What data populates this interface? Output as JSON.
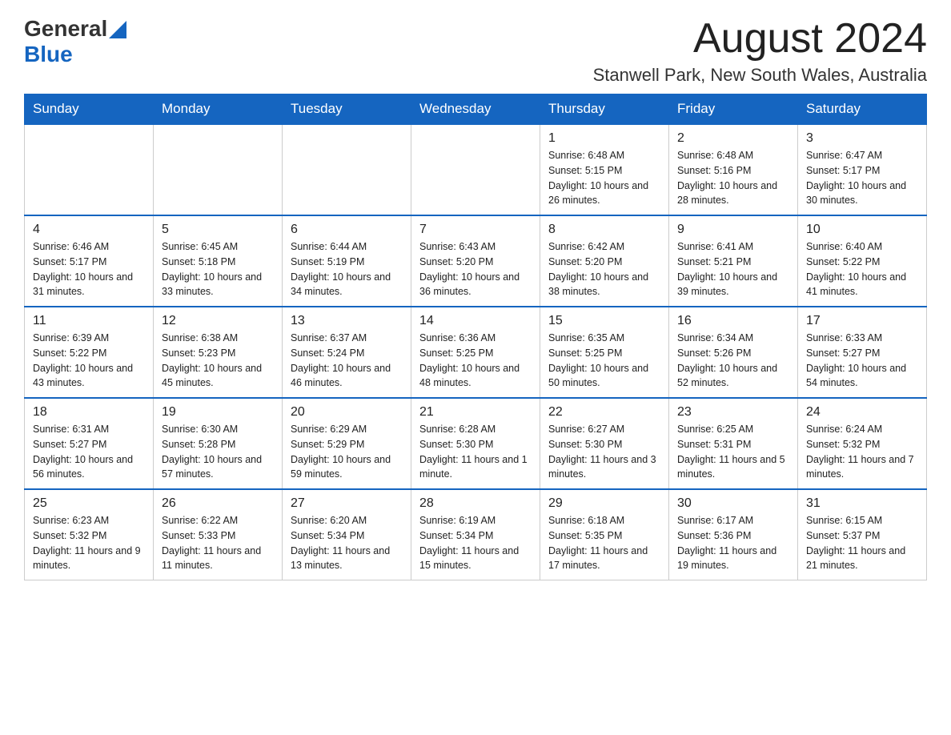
{
  "header": {
    "logo_general": "General",
    "logo_blue": "Blue",
    "month_title": "August 2024",
    "location": "Stanwell Park, New South Wales, Australia"
  },
  "days_of_week": [
    "Sunday",
    "Monday",
    "Tuesday",
    "Wednesday",
    "Thursday",
    "Friday",
    "Saturday"
  ],
  "weeks": [
    {
      "days": [
        {
          "number": "",
          "info": ""
        },
        {
          "number": "",
          "info": ""
        },
        {
          "number": "",
          "info": ""
        },
        {
          "number": "",
          "info": ""
        },
        {
          "number": "1",
          "info": "Sunrise: 6:48 AM\nSunset: 5:15 PM\nDaylight: 10 hours and 26 minutes."
        },
        {
          "number": "2",
          "info": "Sunrise: 6:48 AM\nSunset: 5:16 PM\nDaylight: 10 hours and 28 minutes."
        },
        {
          "number": "3",
          "info": "Sunrise: 6:47 AM\nSunset: 5:17 PM\nDaylight: 10 hours and 30 minutes."
        }
      ]
    },
    {
      "days": [
        {
          "number": "4",
          "info": "Sunrise: 6:46 AM\nSunset: 5:17 PM\nDaylight: 10 hours and 31 minutes."
        },
        {
          "number": "5",
          "info": "Sunrise: 6:45 AM\nSunset: 5:18 PM\nDaylight: 10 hours and 33 minutes."
        },
        {
          "number": "6",
          "info": "Sunrise: 6:44 AM\nSunset: 5:19 PM\nDaylight: 10 hours and 34 minutes."
        },
        {
          "number": "7",
          "info": "Sunrise: 6:43 AM\nSunset: 5:20 PM\nDaylight: 10 hours and 36 minutes."
        },
        {
          "number": "8",
          "info": "Sunrise: 6:42 AM\nSunset: 5:20 PM\nDaylight: 10 hours and 38 minutes."
        },
        {
          "number": "9",
          "info": "Sunrise: 6:41 AM\nSunset: 5:21 PM\nDaylight: 10 hours and 39 minutes."
        },
        {
          "number": "10",
          "info": "Sunrise: 6:40 AM\nSunset: 5:22 PM\nDaylight: 10 hours and 41 minutes."
        }
      ]
    },
    {
      "days": [
        {
          "number": "11",
          "info": "Sunrise: 6:39 AM\nSunset: 5:22 PM\nDaylight: 10 hours and 43 minutes."
        },
        {
          "number": "12",
          "info": "Sunrise: 6:38 AM\nSunset: 5:23 PM\nDaylight: 10 hours and 45 minutes."
        },
        {
          "number": "13",
          "info": "Sunrise: 6:37 AM\nSunset: 5:24 PM\nDaylight: 10 hours and 46 minutes."
        },
        {
          "number": "14",
          "info": "Sunrise: 6:36 AM\nSunset: 5:25 PM\nDaylight: 10 hours and 48 minutes."
        },
        {
          "number": "15",
          "info": "Sunrise: 6:35 AM\nSunset: 5:25 PM\nDaylight: 10 hours and 50 minutes."
        },
        {
          "number": "16",
          "info": "Sunrise: 6:34 AM\nSunset: 5:26 PM\nDaylight: 10 hours and 52 minutes."
        },
        {
          "number": "17",
          "info": "Sunrise: 6:33 AM\nSunset: 5:27 PM\nDaylight: 10 hours and 54 minutes."
        }
      ]
    },
    {
      "days": [
        {
          "number": "18",
          "info": "Sunrise: 6:31 AM\nSunset: 5:27 PM\nDaylight: 10 hours and 56 minutes."
        },
        {
          "number": "19",
          "info": "Sunrise: 6:30 AM\nSunset: 5:28 PM\nDaylight: 10 hours and 57 minutes."
        },
        {
          "number": "20",
          "info": "Sunrise: 6:29 AM\nSunset: 5:29 PM\nDaylight: 10 hours and 59 minutes."
        },
        {
          "number": "21",
          "info": "Sunrise: 6:28 AM\nSunset: 5:30 PM\nDaylight: 11 hours and 1 minute."
        },
        {
          "number": "22",
          "info": "Sunrise: 6:27 AM\nSunset: 5:30 PM\nDaylight: 11 hours and 3 minutes."
        },
        {
          "number": "23",
          "info": "Sunrise: 6:25 AM\nSunset: 5:31 PM\nDaylight: 11 hours and 5 minutes."
        },
        {
          "number": "24",
          "info": "Sunrise: 6:24 AM\nSunset: 5:32 PM\nDaylight: 11 hours and 7 minutes."
        }
      ]
    },
    {
      "days": [
        {
          "number": "25",
          "info": "Sunrise: 6:23 AM\nSunset: 5:32 PM\nDaylight: 11 hours and 9 minutes."
        },
        {
          "number": "26",
          "info": "Sunrise: 6:22 AM\nSunset: 5:33 PM\nDaylight: 11 hours and 11 minutes."
        },
        {
          "number": "27",
          "info": "Sunrise: 6:20 AM\nSunset: 5:34 PM\nDaylight: 11 hours and 13 minutes."
        },
        {
          "number": "28",
          "info": "Sunrise: 6:19 AM\nSunset: 5:34 PM\nDaylight: 11 hours and 15 minutes."
        },
        {
          "number": "29",
          "info": "Sunrise: 6:18 AM\nSunset: 5:35 PM\nDaylight: 11 hours and 17 minutes."
        },
        {
          "number": "30",
          "info": "Sunrise: 6:17 AM\nSunset: 5:36 PM\nDaylight: 11 hours and 19 minutes."
        },
        {
          "number": "31",
          "info": "Sunrise: 6:15 AM\nSunset: 5:37 PM\nDaylight: 11 hours and 21 minutes."
        }
      ]
    }
  ]
}
